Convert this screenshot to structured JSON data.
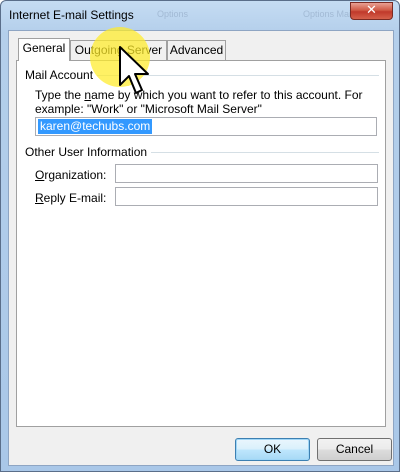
{
  "window": {
    "title": "Internet E-mail Settings",
    "close_glyph": "✕",
    "ghost_text": [
      "Options",
      "Options Mail"
    ]
  },
  "tabs": [
    {
      "label": "General",
      "active": true
    },
    {
      "label": "Outgoing Server",
      "active": false
    },
    {
      "label": "Advanced",
      "active": false
    }
  ],
  "mail_account": {
    "group_label": "Mail Account",
    "description": "Type the name by which you want to refer to this account. For example: \"Work\" or \"Microsoft Mail Server\"",
    "account_name_value": "karen@techubs.com"
  },
  "other_user_info": {
    "group_label": "Other User Information",
    "organization_label": "Organization:",
    "organization_value": "",
    "reply_email_label": "Reply E-mail:",
    "reply_email_value": ""
  },
  "buttons": {
    "ok": "OK",
    "cancel": "Cancel"
  },
  "icons": {
    "cursor": "pointer-arrow-icon",
    "close": "close-icon"
  },
  "colors": {
    "selection": "#3399ff",
    "highlight": "#ffeb28",
    "close_button": "#c0392b"
  }
}
